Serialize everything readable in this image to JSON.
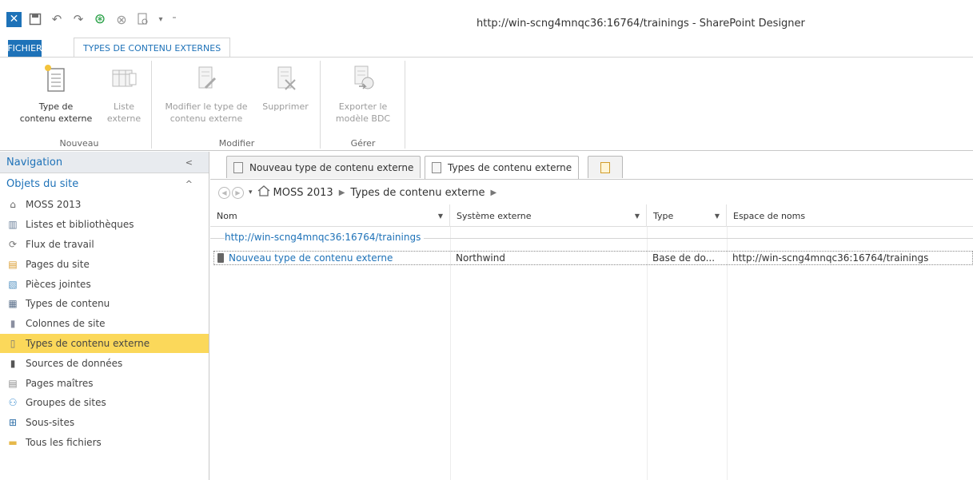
{
  "window": {
    "title": "http://win-scng4mnqc36:16764/trainings - SharePoint Designer"
  },
  "quick_access": {
    "icons": [
      "sharepoint-designer-logo",
      "save-icon",
      "undo-icon",
      "redo-icon",
      "refresh-icon",
      "stop-icon",
      "preview-icon",
      "dropdown-icon",
      "customize-icon"
    ]
  },
  "ribbon": {
    "tabs": [
      "FICHIER",
      "TYPES DE CONTENU EXTERNES"
    ],
    "groups": [
      {
        "label": "Nouveau",
        "buttons": [
          {
            "line1": "Type de",
            "line2": "contenu externe",
            "enabled": true
          },
          {
            "line1": "Liste",
            "line2": "externe",
            "enabled": false
          }
        ]
      },
      {
        "label": "Modifier",
        "buttons": [
          {
            "line1": "Modifier le type de",
            "line2": "contenu externe",
            "enabled": false
          },
          {
            "line1": "Supprimer",
            "line2": "",
            "enabled": false
          }
        ]
      },
      {
        "label": "Gérer",
        "buttons": [
          {
            "line1": "Exporter le",
            "line2": "modèle BDC",
            "enabled": false
          }
        ]
      }
    ]
  },
  "navigation": {
    "header": "Navigation",
    "section": "Objets du site",
    "items": [
      {
        "label": "MOSS 2013",
        "icon": "home-icon"
      },
      {
        "label": "Listes et bibliothèques",
        "icon": "list-icon"
      },
      {
        "label": "Flux de travail",
        "icon": "workflow-icon"
      },
      {
        "label": "Pages du site",
        "icon": "site-pages-icon"
      },
      {
        "label": "Pièces jointes",
        "icon": "attachments-icon"
      },
      {
        "label": "Types de contenu",
        "icon": "content-type-icon"
      },
      {
        "label": "Colonnes de site",
        "icon": "site-column-icon"
      },
      {
        "label": "Types de contenu externe",
        "icon": "external-content-type-icon",
        "selected": true
      },
      {
        "label": "Sources de données",
        "icon": "data-source-icon"
      },
      {
        "label": "Pages maîtres",
        "icon": "master-page-icon"
      },
      {
        "label": "Groupes de sites",
        "icon": "site-groups-icon"
      },
      {
        "label": "Sous-sites",
        "icon": "subsites-icon"
      },
      {
        "label": "Tous les fichiers",
        "icon": "folder-icon"
      }
    ]
  },
  "doc_tabs": [
    {
      "label": "Nouveau type de contenu externe",
      "active": false
    },
    {
      "label": "Types de contenu externe",
      "active": true
    }
  ],
  "breadcrumb": {
    "items": [
      "MOSS 2013",
      "Types de contenu externe"
    ]
  },
  "table": {
    "columns": [
      "Nom",
      "Système externe",
      "Type",
      "Espace de noms"
    ],
    "group": "http://win-scng4mnqc36:16764/trainings",
    "rows": [
      {
        "name": "Nouveau type de contenu externe",
        "external_system": "Northwind",
        "type": "Base de do...",
        "namespace": "http://win-scng4mnqc36:16764/trainings"
      }
    ]
  },
  "colors": {
    "accent": "#1e72b8",
    "selection": "#fbd85a"
  }
}
